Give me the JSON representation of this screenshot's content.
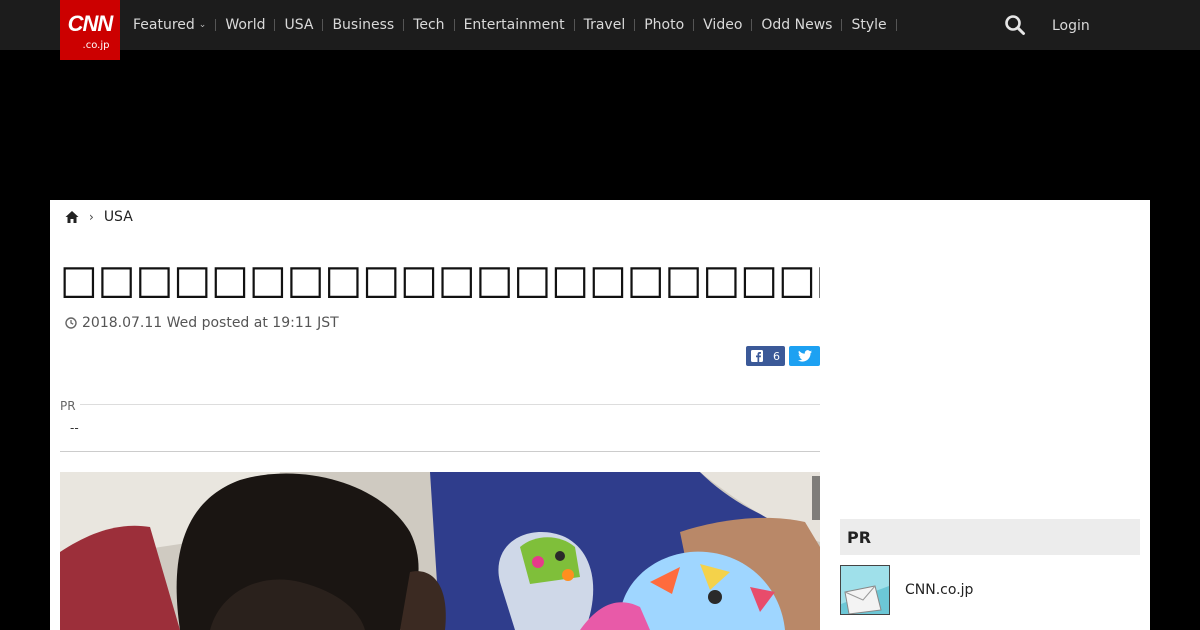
{
  "brand": {
    "logo_main": "CNN",
    "logo_sub": ".co.jp",
    "color": "#cc0000"
  },
  "nav": {
    "items": [
      {
        "label": "Featured",
        "has_dropdown": true
      },
      {
        "label": "World"
      },
      {
        "label": "USA"
      },
      {
        "label": "Business"
      },
      {
        "label": "Tech"
      },
      {
        "label": "Entertainment"
      },
      {
        "label": "Travel"
      },
      {
        "label": "Photo"
      },
      {
        "label": "Video"
      },
      {
        "label": "Odd News"
      },
      {
        "label": "Style"
      }
    ],
    "search_icon": "search-icon",
    "login_label": "Login"
  },
  "breadcrumb": {
    "home_icon": "home-icon",
    "section": "USA"
  },
  "article": {
    "title": "□□□□□□□□□□□□□□□□□□□□□□□□□□□□□□□□",
    "timestamp": "2018.07.11 Wed posted at 19:11 JST",
    "share": {
      "facebook_count": "6",
      "facebook_color": "#3b5998",
      "twitter_color": "#1da1f2"
    },
    "pr_label": "PR",
    "pr_text": "--"
  },
  "sidebar": {
    "pr_heading": "PR",
    "item_label": "CNN.co.jp"
  }
}
